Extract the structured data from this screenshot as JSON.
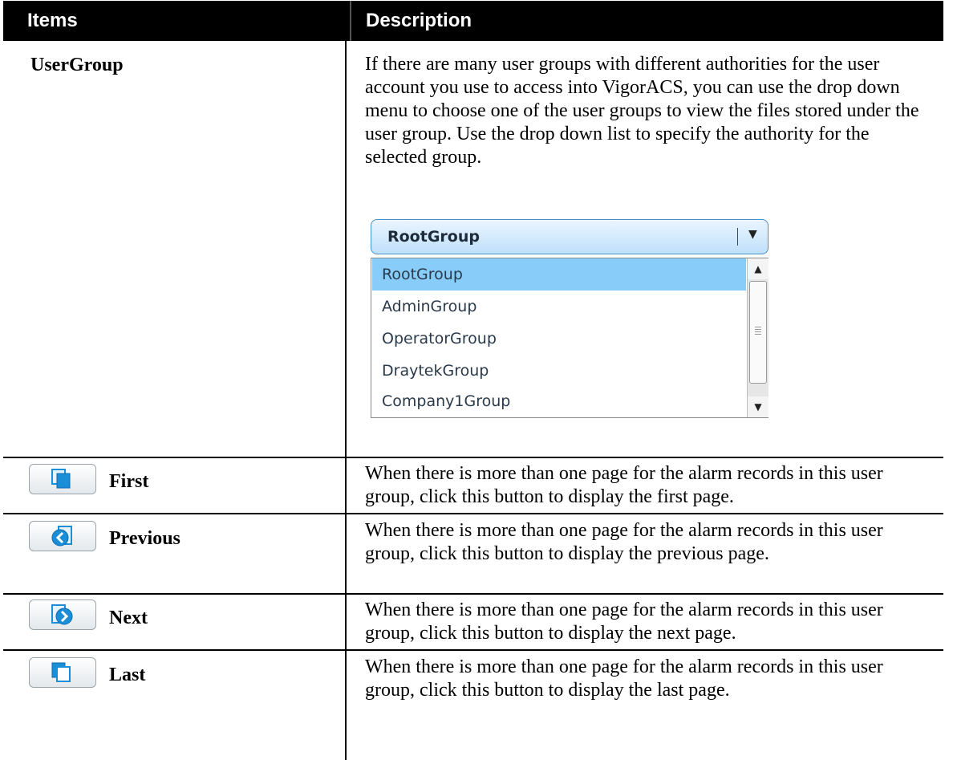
{
  "header": {
    "items_label": "Items",
    "description_label": "Description"
  },
  "rows": [
    {
      "label": "UserGroup",
      "description": "If there are many user groups with different authorities for the user account you use to access into VigorACS, you can use the drop down menu to choose one of the user groups to view the files stored under the user group. Use the drop down list to specify the authority for the selected group."
    },
    {
      "label": "First",
      "description": "When there is more than one page for the alarm records in this user group, click this button to display the first page."
    },
    {
      "label": "Previous",
      "description": "When there is more than one page for the alarm records in this user group, click this button to display the previous page."
    },
    {
      "label": "Next",
      "description": "When there is more than one page for the alarm records in this user group, click this button to display the next page."
    },
    {
      "label": "Last",
      "description": "When there is more than one page for the alarm records in this user group, click this button to display the last page."
    }
  ],
  "dropdown": {
    "selected": "RootGroup",
    "options": [
      "RootGroup",
      "AdminGroup",
      "OperatorGroup",
      "DraytekGroup",
      "Company1Group"
    ]
  },
  "icons": {
    "first": "first-page-icon",
    "previous": "previous-page-icon",
    "next": "next-page-icon",
    "last": "last-page-icon"
  },
  "colors": {
    "header_bg": "#000000",
    "header_text": "#ffffff",
    "selected_option": "#88ccfa",
    "icon_blue": "#1a8fd8"
  }
}
